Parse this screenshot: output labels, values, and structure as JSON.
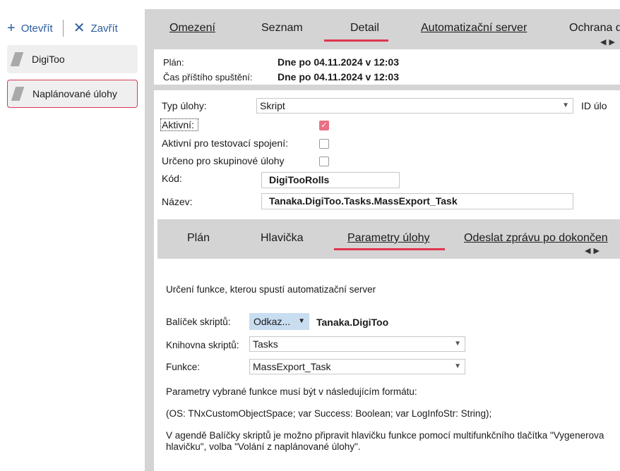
{
  "toolbar": {
    "open_label": "Otevřít",
    "close_label": "Zavřít"
  },
  "sidebar": {
    "items": [
      {
        "label": "DigiToo"
      },
      {
        "label": "Naplánované úlohy"
      }
    ]
  },
  "main_tabs": [
    "Omezení",
    "Seznam",
    "Detail",
    "Automatizační server",
    "Ochrana d"
  ],
  "main_tab_active": "Detail",
  "info": {
    "plan_label": "Plán:",
    "plan_value": "Dne po 04.11.2024 v 12:03",
    "next_label": "Čas příštího spuštění:",
    "next_value": "Dne po 04.11.2024 v 12:03"
  },
  "form": {
    "type_label": "Typ úlohy:",
    "type_value": "Skript",
    "id_label": "ID úlo",
    "active_label": "Aktivní:",
    "active_checked": true,
    "test_label": "Aktivní pro testovací spojení:",
    "test_checked": false,
    "group_label": "Určeno pro skupinové úlohy",
    "group_checked": false,
    "code_label": "Kód:",
    "code_value": "DigiTooRolls",
    "name_label": "Název:",
    "name_value": "Tanaka.DigiToo.Tasks.MassExport_Task"
  },
  "sub_tabs": [
    "Plán",
    "Hlavička",
    "Parametry úlohy",
    "Odeslat zprávu po dokončen"
  ],
  "sub_tab_active": "Parametry úlohy",
  "params": {
    "intro": "Určení funkce, kterou spustí automatizační server",
    "package_label": "Balíček skriptů:",
    "package_button": "Odkaz...",
    "package_value": "Tanaka.DigiToo",
    "library_label": "Knihovna skriptů:",
    "library_value": "Tasks",
    "function_label": "Funkce:",
    "function_value": "MassExport_Task",
    "note1": "Parametry vybrané funkce musí být v následujícím formátu:",
    "note2": "(OS: TNxCustomObjectSpace; var Success: Boolean; var LogInfoStr: String);",
    "note3a": "V agendě Balíčky skriptů je možno připravit hlavičku funkce pomocí multifunkčního tlačítka \"Vygenerova",
    "note3b": "hlavičku\", volba \"Volání z naplánované úlohy\"."
  },
  "colors": {
    "accent": "#e0344f",
    "link": "#2b5c9f",
    "panel": "#d4d4d4",
    "checkbox_on": "#ea6f84",
    "dropdown_button": "#c9ddf1"
  }
}
